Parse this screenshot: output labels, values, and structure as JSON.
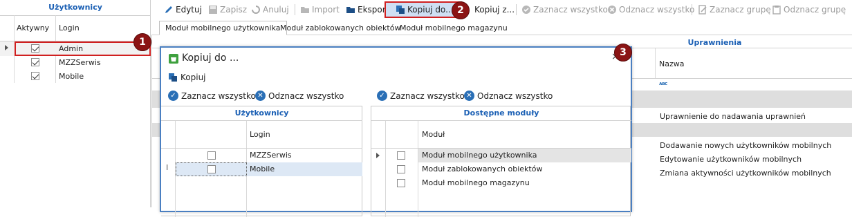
{
  "left_panel": {
    "title": "Użytkownicy",
    "col_active": "Aktywny",
    "col_login": "Login",
    "rows": [
      {
        "login": "Admin",
        "active": true
      },
      {
        "login": "MZZSerwis",
        "active": true
      },
      {
        "login": "Mobile",
        "active": true
      }
    ]
  },
  "toolbar": {
    "edit": "Edytuj",
    "save": "Zapisz",
    "cancel": "Anuluj",
    "import": "Import",
    "export": "Eksport",
    "copy_to": "Kopiuj do...",
    "copy_from": "Kopiuj z...",
    "select_all": "Zaznacz wszystko",
    "deselect_all": "Odznacz wszystko",
    "select_group": "Zaznacz grupę",
    "deselect_group": "Odznacz grupę"
  },
  "tabs": [
    "Moduł mobilnego użytkownika",
    "Moduł zablokowanych obiektów",
    "Moduł mobilnego magazynu"
  ],
  "permissions": {
    "header": "Uprawnienia",
    "col_name": "Nazwa",
    "filter_icon": "abc-filter-icon",
    "rows": [
      "Uprawnienie do nadawania uprawnień",
      "Dodawanie nowych użytkowników mobilnych",
      "Edytowanie użytkowników mobilnych",
      "Zmiana aktywności użytkowników mobilnych"
    ]
  },
  "dialog": {
    "title": "Kopiuj do ...",
    "copy_label": "Kopiuj",
    "select_all": "Zaznacz wszystko",
    "deselect_all": "Odznacz wszystko",
    "users_header": "Użytkownicy",
    "users_col_login": "Login",
    "users_rows": [
      {
        "login": "MZZSerwis",
        "checked": false
      },
      {
        "login": "Mobile",
        "checked": false
      }
    ],
    "modules_header": "Dostępne moduły",
    "modules_col": "Moduł",
    "modules_rows": [
      {
        "name": "Moduł mobilnego użytkownika",
        "checked": false
      },
      {
        "name": "Moduł zablokowanych obiektów",
        "checked": false
      },
      {
        "name": "Moduł mobilnego magazynu",
        "checked": false
      }
    ],
    "close_glyph": "×"
  },
  "badges": [
    "1",
    "2",
    "3"
  ],
  "colors": {
    "accent": "#1a5fb4",
    "badge": "#8b1414",
    "highlight_border": "#d02020",
    "selected_row": "#dde8f5"
  }
}
